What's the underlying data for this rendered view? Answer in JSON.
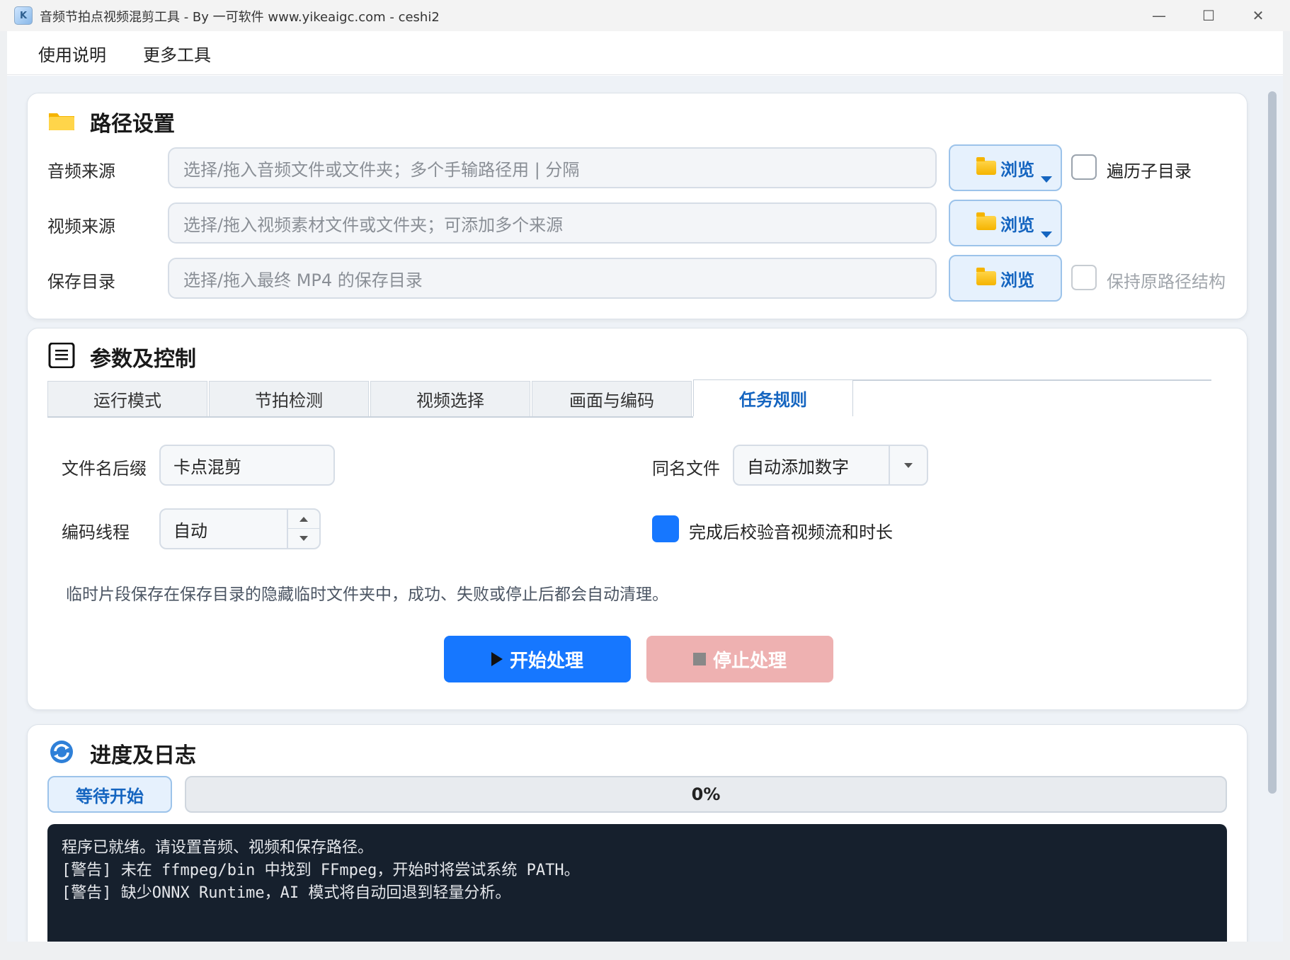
{
  "window": {
    "title": "音频节拍点视频混剪工具 - By 一可软件 www.yikeaigc.com - ceshi2",
    "controls": [
      "—",
      "☐",
      "✕"
    ]
  },
  "menu": {
    "items": [
      "使用说明",
      "更多工具"
    ]
  },
  "path_settings": {
    "title": "路径设置",
    "icon": "folder-icon",
    "rows": [
      {
        "label": "音频来源",
        "placeholder": "选择/拖入音频文件或文件夹；多个手输路径用 | 分隔",
        "browse_label": "浏览",
        "option_label": "遍历子目录",
        "has_dropdown": true
      },
      {
        "label": "视频来源",
        "placeholder": "选择/拖入视频素材文件或文件夹；可添加多个来源",
        "browse_label": "浏览",
        "has_dropdown": true
      },
      {
        "label": "保存目录",
        "placeholder": "选择/拖入最终 MP4 的保存目录",
        "browse_label": "浏览",
        "option_label": "保持原路径结构",
        "option_disabled": true,
        "has_dropdown": false
      }
    ]
  },
  "params": {
    "title": "参数及控制",
    "icon": "document-list-icon",
    "tabs": [
      "运行模式",
      "节拍检测",
      "视频选择",
      "画面与编码",
      "任务规则"
    ],
    "active_tab": "任务规则",
    "fields": {
      "filename_suffix_label": "文件名后缀",
      "filename_suffix_value": "卡点混剪",
      "same_name_label": "同名文件",
      "same_name_value": "自动添加数字",
      "encode_threads_label": "编码线程",
      "encode_threads_value": "自动",
      "verify_label": "完成后校验音视频流和时长",
      "verify_checked": true
    },
    "hint": "临时片段保存在保存目录的隐藏临时文件夹中，成功、失败或停止后都会自动清理。",
    "start_label": "开始处理",
    "stop_label": "停止处理"
  },
  "progress": {
    "title": "进度及日志",
    "icon": "refresh-icon",
    "status": "等待开始",
    "percent_text": "0%",
    "percent": 0,
    "log": [
      "程序已就绪。请设置音频、视频和保存路径。",
      "[警告] 未在 ffmpeg/bin 中找到 FFmpeg，开始时将尝试系统 PATH。",
      "[警告] 缺少ONNX Runtime，AI 模式将自动回退到轻量分析。"
    ]
  },
  "colors": {
    "accent": "#1677ff",
    "stop_button": "#eeb1b1",
    "log_background": "#16202d"
  }
}
